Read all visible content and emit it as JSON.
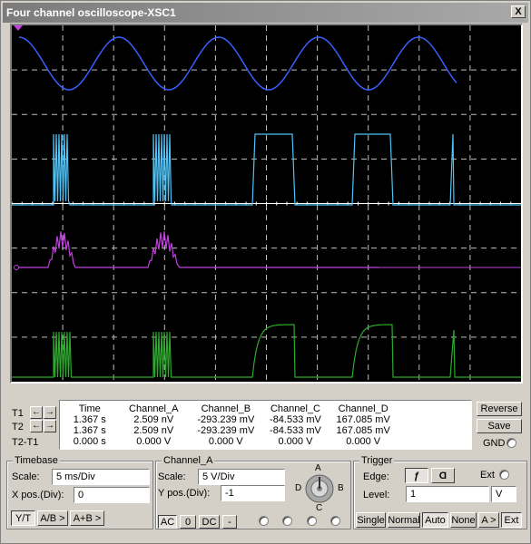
{
  "window": {
    "title": "Four channel oscilloscope-XSC1",
    "close_label": "X"
  },
  "display": {
    "grid": {
      "cols": 10,
      "rows": 8
    },
    "trace_colors": {
      "A": "#3a5fff",
      "B": "#4fc3f7",
      "C": "#c040e0",
      "D": "#2ea82e"
    },
    "ground_marker_color": "#c040e0"
  },
  "cursors": {
    "t1_label": "T1",
    "t2_label": "T2",
    "t2t1_label": "T2-T1",
    "left_arrow": "←",
    "right_arrow": "→"
  },
  "measurements": {
    "headers": [
      "Time",
      "Channel_A",
      "Channel_B",
      "Channel_C",
      "Channel_D"
    ],
    "rows": [
      [
        "1.367 s",
        "2.509 nV",
        "-293.239 mV",
        "-84.533 mV",
        "167.085 mV"
      ],
      [
        "1.367 s",
        "2.509 nV",
        "-293.239 mV",
        "-84.533 mV",
        "167.085 mV"
      ],
      [
        "0.000 s",
        "0.000 V",
        "0.000 V",
        "0.000 V",
        "0.000 V"
      ]
    ]
  },
  "side_buttons": {
    "reverse": "Reverse",
    "save": "Save",
    "gnd": "GND"
  },
  "timebase": {
    "title": "Timebase",
    "scale_label": "Scale:",
    "scale_value": "5 ms/Div",
    "xpos_label": "X pos.(Div):",
    "xpos_value": "0",
    "modes": [
      "Y/T",
      "A/B >",
      "A+B >"
    ],
    "active_mode": "Y/T"
  },
  "channel": {
    "title": "Channel_A",
    "scale_label": "Scale:",
    "scale_value": "5  V/Div",
    "ypos_label": "Y pos.(Div):",
    "ypos_value": "-1",
    "coupling": [
      "AC",
      "0",
      "DC",
      "-"
    ],
    "active_coupling": "AC",
    "knob_labels": {
      "A": "A",
      "B": "B",
      "C": "C",
      "D": "D"
    }
  },
  "trigger": {
    "title": "Trigger",
    "edge_label": "Edge:",
    "ext_label": "Ext",
    "rising_edge": "ƒ",
    "falling_edge": "Ɑ",
    "level_label": "Level:",
    "level_value": "1",
    "level_unit": "V",
    "modes": [
      "Single",
      "Normal",
      "Auto",
      "None",
      "A >",
      "Ext"
    ],
    "active_mode": "Auto"
  }
}
